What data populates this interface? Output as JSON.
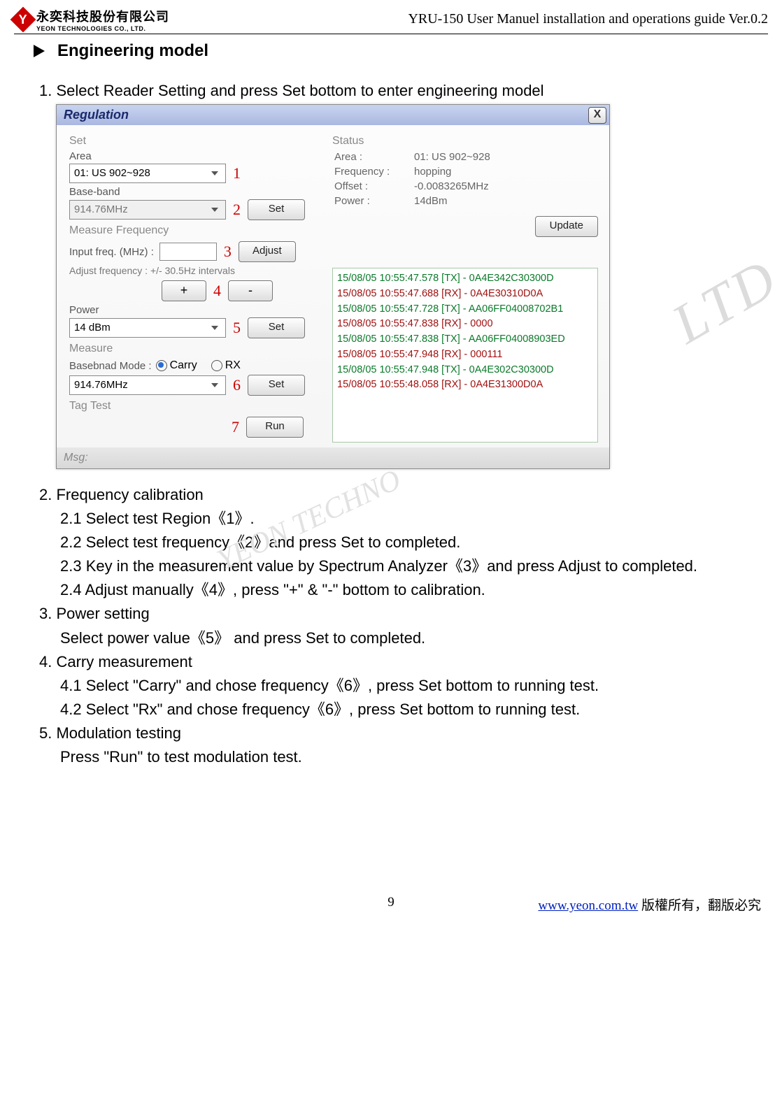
{
  "header": {
    "company_cn": "永奕科技股份有限公司",
    "company_en": "YEON TECHNOLOGIES CO., LTD.",
    "logo_letter": "Y",
    "doc_title": "YRU-150 User Manuel installation and operations guide Ver.0.2"
  },
  "section_title": "Engineering model",
  "step1": "1. Select Reader Setting and press Set bottom to enter engineering model",
  "ui": {
    "window_title": "Regulation",
    "set_group": "Set",
    "area_label": "Area",
    "area_value": "01: US 902~928",
    "baseband_label": "Base-band",
    "baseband_value": "914.76MHz",
    "set_btn": "Set",
    "measure_freq_label": "Measure Frequency",
    "input_freq_label": "Input freq. (MHz) :",
    "adjust_btn": "Adjust",
    "adjust_note": "Adjust frequency : +/- 30.5Hz intervals",
    "plus": "+",
    "minus": "-",
    "power_label": "Power",
    "power_value": "14 dBm",
    "measure_label": "Measure",
    "baseband_mode_label": "Basebnad Mode :",
    "carry_label": "Carry",
    "rx_label": "RX",
    "measure_combo": "914.76MHz",
    "tag_test_label": "Tag Test",
    "run_btn": "Run",
    "status_group": "Status",
    "status": {
      "area_k": "Area :",
      "area_v": "01: US 902~928",
      "freq_k": "Frequency :",
      "freq_v": "hopping",
      "offset_k": "Offset :",
      "offset_v": "-0.0083265MHz",
      "power_k": "Power :",
      "power_v": "14dBm"
    },
    "update_btn": "Update",
    "log": [
      {
        "cls": "log-tx",
        "t": "15/08/05 10:55:47.578 [TX] - 0A4E342C30300D"
      },
      {
        "cls": "log-rx",
        "t": "15/08/05 10:55:47.688 [RX] - 0A4E30310D0A"
      },
      {
        "cls": "log-tx",
        "t": "15/08/05 10:55:47.728 [TX] - AA06FF04008702B1"
      },
      {
        "cls": "log-rx",
        "t": "15/08/05 10:55:47.838 [RX] - 0000"
      },
      {
        "cls": "log-tx",
        "t": "15/08/05 10:55:47.838 [TX] - AA06FF04008903ED"
      },
      {
        "cls": "log-rx",
        "t": "15/08/05 10:55:47.948 [RX] - 000111"
      },
      {
        "cls": "log-tx",
        "t": "15/08/05 10:55:47.948 [TX] - 0A4E302C30300D"
      },
      {
        "cls": "log-rx",
        "t": "15/08/05 10:55:48.058 [RX] - 0A4E31300D0A"
      }
    ],
    "msg_label": "Msg:",
    "ann": {
      "n1": "1",
      "n2": "2",
      "n3": "3",
      "n4": "4",
      "n5": "5",
      "n6": "6",
      "n7": "7"
    }
  },
  "instr": {
    "i2": "2. Frequency calibration",
    "i21": "2.1 Select test Region《1》.",
    "i22": "2.2 Select test frequency《2》and press Set to completed.",
    "i23": "2.3 Key in the measurement value by Spectrum Analyzer《3》and press Adjust to completed.",
    "i24": "2.4 Adjust manually《4》, press \"+\" & \"-\" bottom to calibration.",
    "i3": "3. Power setting",
    "i3s": "Select power value《5》  and press Set to completed.",
    "i4": "4. Carry measurement",
    "i41": "4.1 Select \"Carry\" and chose frequency《6》, press Set bottom to running test.",
    "i42": "4.2 Select \"Rx\" and chose frequency《6》, press Set bottom to running test.",
    "i5": "5. Modulation testing",
    "i5s": "Press \"Run\" to test modulation test."
  },
  "watermark1": "LTD.",
  "watermark2": "YEON  TECHNO",
  "footer": {
    "page": "9",
    "link": "www.yeon.com.tw",
    "copyright": "  版權所有，翻版必究"
  }
}
